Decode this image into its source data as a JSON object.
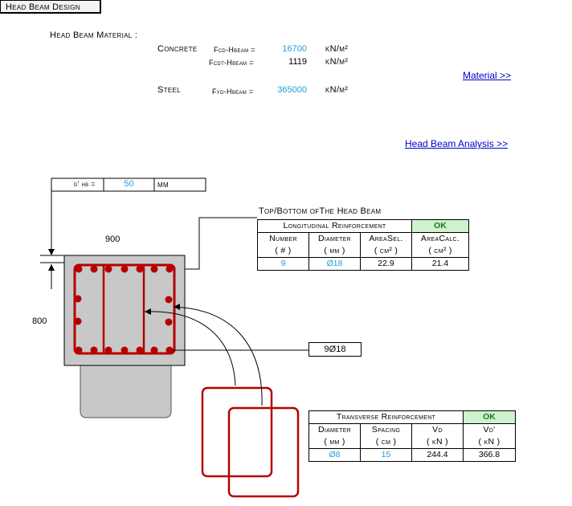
{
  "header": {
    "title": "Head Beam Design"
  },
  "material": {
    "heading": "Head Beam Material :",
    "concrete_label": "Concrete",
    "fcd_label": "Fcd-Hbeam =",
    "fcd_value": "16700",
    "fcd_unit": "kN/m²",
    "fcdt_label": "Fcdt-Hbeam =",
    "fcdt_value": "1119",
    "fcdt_unit": "kN/m²",
    "steel_label": "Steel",
    "fyd_label": "Fyd-Hbeam =",
    "fyd_value": "365000",
    "fyd_unit": "kN/m²"
  },
  "links": {
    "material": "Material >>",
    "analysis": "Head Beam Analysis >>"
  },
  "cover": {
    "label": "d' hb =",
    "value": "50",
    "unit": "mm"
  },
  "section": {
    "width": "900",
    "height": "800",
    "bar_callout": "9Ø18"
  },
  "longitudinal": {
    "caption": "Top/Bottom ofThe Head Beam",
    "title": "Longitudinal Reinforcement",
    "status": "OK",
    "headers": [
      "Number",
      "Diameter",
      "AreaSel.",
      "AreaCalc."
    ],
    "units": [
      "( # )",
      "( mm )",
      "( cm² )",
      "( cm² )"
    ],
    "values": [
      "9",
      "Ø18",
      "22.9",
      "21.4"
    ]
  },
  "transverse": {
    "title": "Transverse Reinforcement",
    "status": "OK",
    "headers": [
      "Diameter",
      "Spacing",
      "Vd",
      "Vd'"
    ],
    "units": [
      "( mm )",
      "( cm )",
      "( kN )",
      "( kN )"
    ],
    "values": [
      "Ø8",
      "15",
      "244.4",
      "366.8"
    ]
  },
  "colors": {
    "rebar": "#b50000",
    "input": "#1fa0d8",
    "ok_bg": "#cdf2cd",
    "ok_text": "#1c7a1c"
  }
}
